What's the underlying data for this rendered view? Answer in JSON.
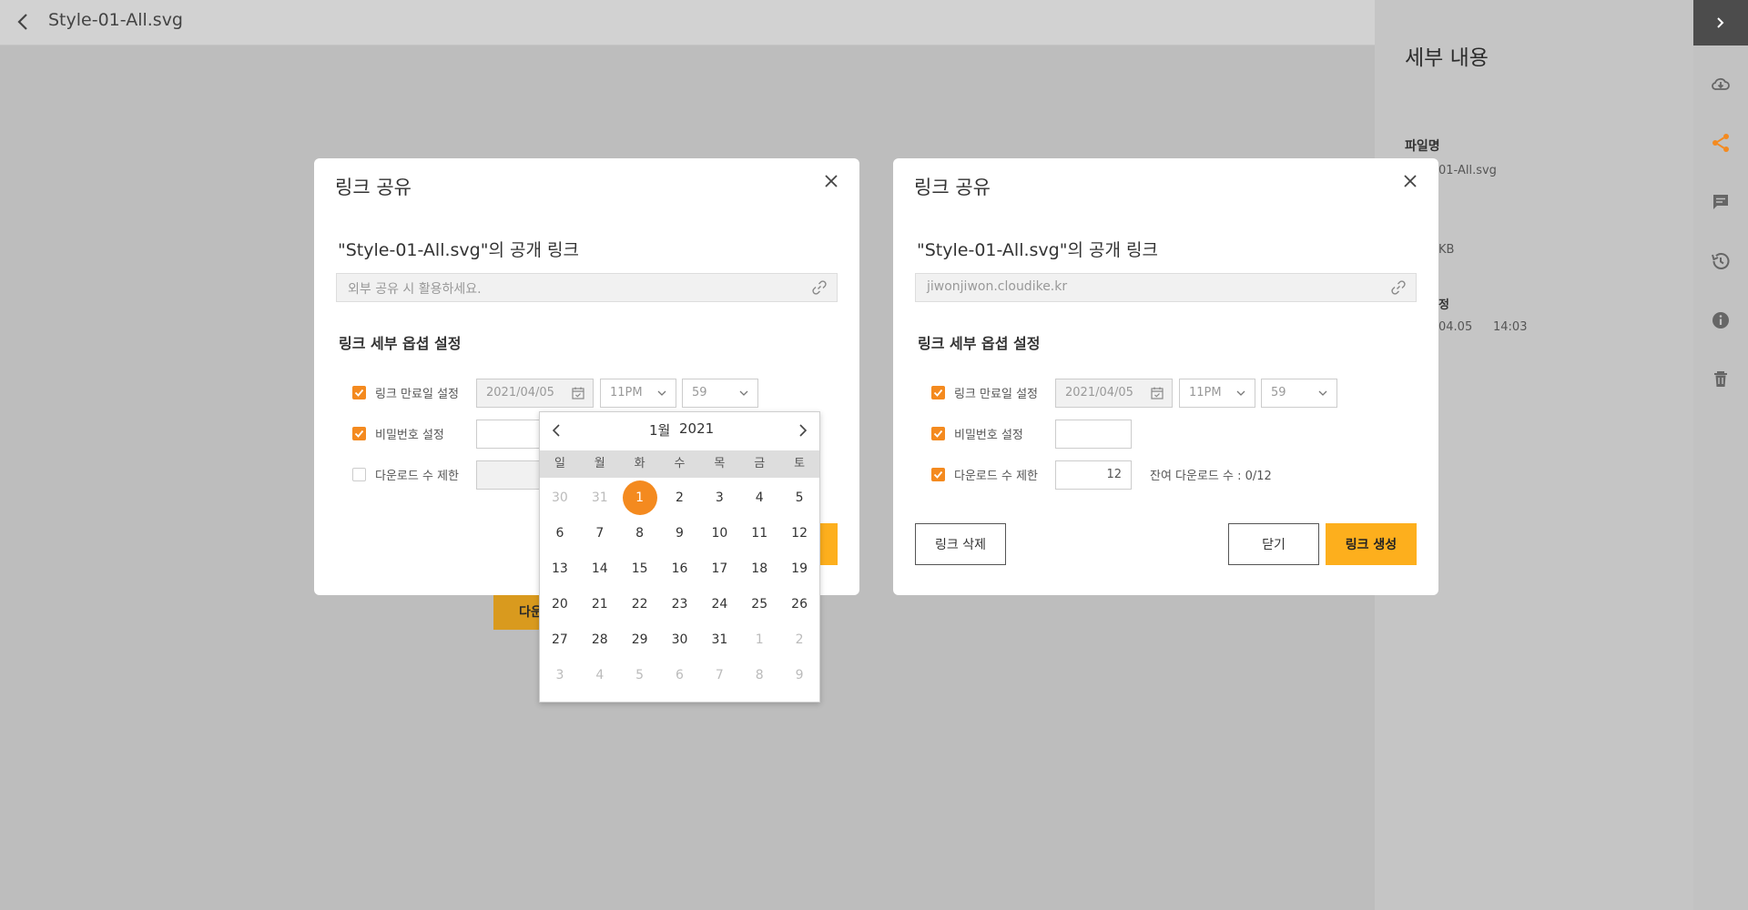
{
  "topbar": {
    "title": "Style-01-All.svg"
  },
  "behind_button": {
    "label": "다운"
  },
  "details_panel": {
    "title": "세부 내용",
    "file_name_label": "파일명",
    "file_name_value": "01-All.svg",
    "size_value": "KB",
    "modified_label_fragment": "정",
    "modified_date": "04.05",
    "modified_time": "14:03"
  },
  "rail": {
    "icons": [
      "cloud-download-icon",
      "share-icon",
      "comment-icon",
      "history-icon",
      "info-icon",
      "trash-icon"
    ]
  },
  "dialog_left": {
    "title": "링크 공유",
    "subtitle": "\"Style-01-All.svg\"의 공개 링크",
    "link_placeholder": "외부 공유 시 활용하세요.",
    "options_title": "링크 세부 옵셥 설정",
    "expire_label": "링크 만료일 설정",
    "expire_date": "2021/04/05",
    "expire_hour": "11PM",
    "expire_minute": "59",
    "password_label": "비밀번호 설정",
    "download_limit_label": "다운로드 수 제한"
  },
  "dialog_right": {
    "title": "링크 공유",
    "subtitle": "\"Style-01-All.svg\"의 공개 링크",
    "link_value": "jiwonjiwon.cloudike.kr",
    "options_title": "링크 세부 옵셥 설정",
    "expire_label": "링크 만료일 설정",
    "expire_date": "2021/04/05",
    "expire_hour": "11PM",
    "expire_minute": "59",
    "password_label": "비밀번호 설정",
    "download_limit_label": "다운로드 수 제한",
    "download_limit_value": "12",
    "remaining_text": "잔여 다운로드 수 : 0/12",
    "delete_button": "링크 삭제",
    "close_button": "닫기",
    "create_button": "링크 생성"
  },
  "calendar": {
    "month": "1월",
    "year": "2021",
    "weekdays": [
      "일",
      "월",
      "화",
      "수",
      "목",
      "금",
      "토"
    ],
    "days": [
      {
        "d": "30",
        "muted": true
      },
      {
        "d": "31",
        "muted": true
      },
      {
        "d": "1",
        "selected": true
      },
      {
        "d": "2"
      },
      {
        "d": "3"
      },
      {
        "d": "4"
      },
      {
        "d": "5"
      },
      {
        "d": "6"
      },
      {
        "d": "7"
      },
      {
        "d": "8"
      },
      {
        "d": "9"
      },
      {
        "d": "10"
      },
      {
        "d": "11"
      },
      {
        "d": "12"
      },
      {
        "d": "13"
      },
      {
        "d": "14"
      },
      {
        "d": "15"
      },
      {
        "d": "16"
      },
      {
        "d": "17"
      },
      {
        "d": "18"
      },
      {
        "d": "19"
      },
      {
        "d": "20"
      },
      {
        "d": "21"
      },
      {
        "d": "22"
      },
      {
        "d": "23"
      },
      {
        "d": "24"
      },
      {
        "d": "25"
      },
      {
        "d": "26"
      },
      {
        "d": "27"
      },
      {
        "d": "28"
      },
      {
        "d": "29"
      },
      {
        "d": "30"
      },
      {
        "d": "31"
      },
      {
        "d": "1",
        "muted": true
      },
      {
        "d": "2",
        "muted": true
      },
      {
        "d": "3",
        "muted": true
      },
      {
        "d": "4",
        "muted": true
      },
      {
        "d": "5",
        "muted": true
      },
      {
        "d": "6",
        "muted": true
      },
      {
        "d": "7",
        "muted": true
      },
      {
        "d": "8",
        "muted": true
      },
      {
        "d": "9",
        "muted": true
      }
    ]
  },
  "colors": {
    "accent": "#f48a1f",
    "primary_button": "#fdaf1d"
  }
}
